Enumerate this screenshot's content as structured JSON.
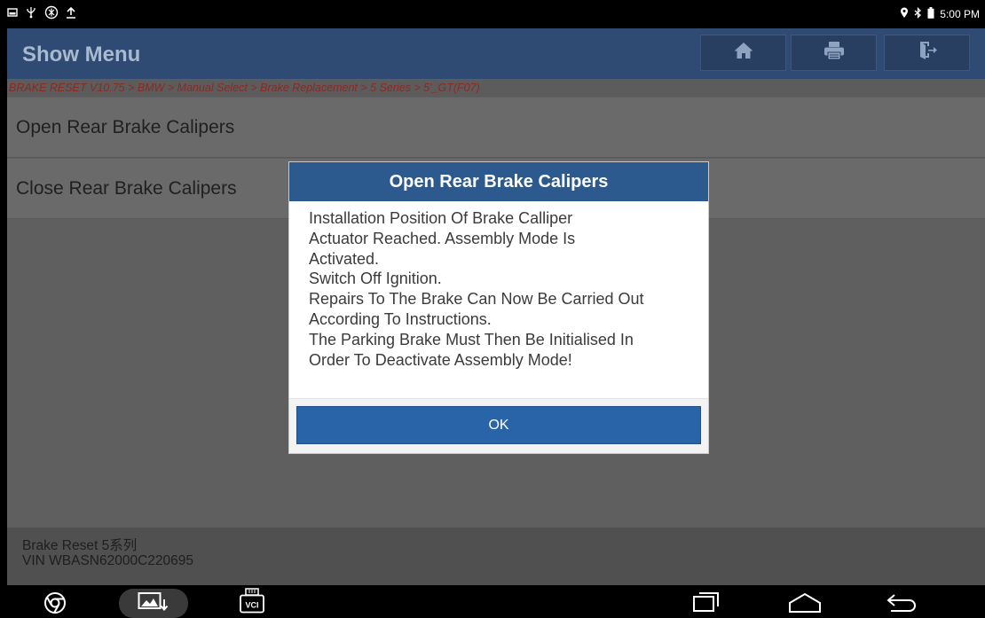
{
  "status_bar": {
    "left_icons": [
      "screenshot-icon",
      "usb-icon",
      "settings-icon",
      "upload-icon"
    ],
    "right_icons": [
      "location-icon",
      "bluetooth-icon",
      "battery-icon"
    ],
    "time": "5:00 PM"
  },
  "header": {
    "title": "Show Menu",
    "buttons": [
      "home-icon",
      "print-icon",
      "exit-icon"
    ]
  },
  "breadcrumb": "BRAKE RESET V10.75 > BMW > Manual Select > Brake Replacement > 5 Series > 5'_GT(F07)",
  "menu": {
    "items": [
      {
        "label": "Open Rear Brake Calipers"
      },
      {
        "label": "Close Rear Brake Calipers"
      }
    ]
  },
  "footer": {
    "line1": "Brake Reset 5系列",
    "line2": "VIN WBASN62000C220695"
  },
  "dialog": {
    "title": "Open Rear Brake Calipers",
    "lines": [
      "Installation Position Of Brake Calliper",
      "Actuator Reached. Assembly Mode Is",
      "Activated.",
      "Switch Off Ignition.",
      "Repairs To The Brake Can Now Be Carried Out",
      "According To Instructions.",
      "The Parking Brake Must Then Be Initialised In",
      "Order To Deactivate Assembly Mode!"
    ],
    "ok_label": "OK"
  },
  "nav_bar": {
    "vci_label": "VCI",
    "icons": [
      "chrome-icon",
      "gallery-icon",
      "vci-icon",
      "recent-apps-icon",
      "home-nav-icon",
      "back-icon"
    ]
  }
}
